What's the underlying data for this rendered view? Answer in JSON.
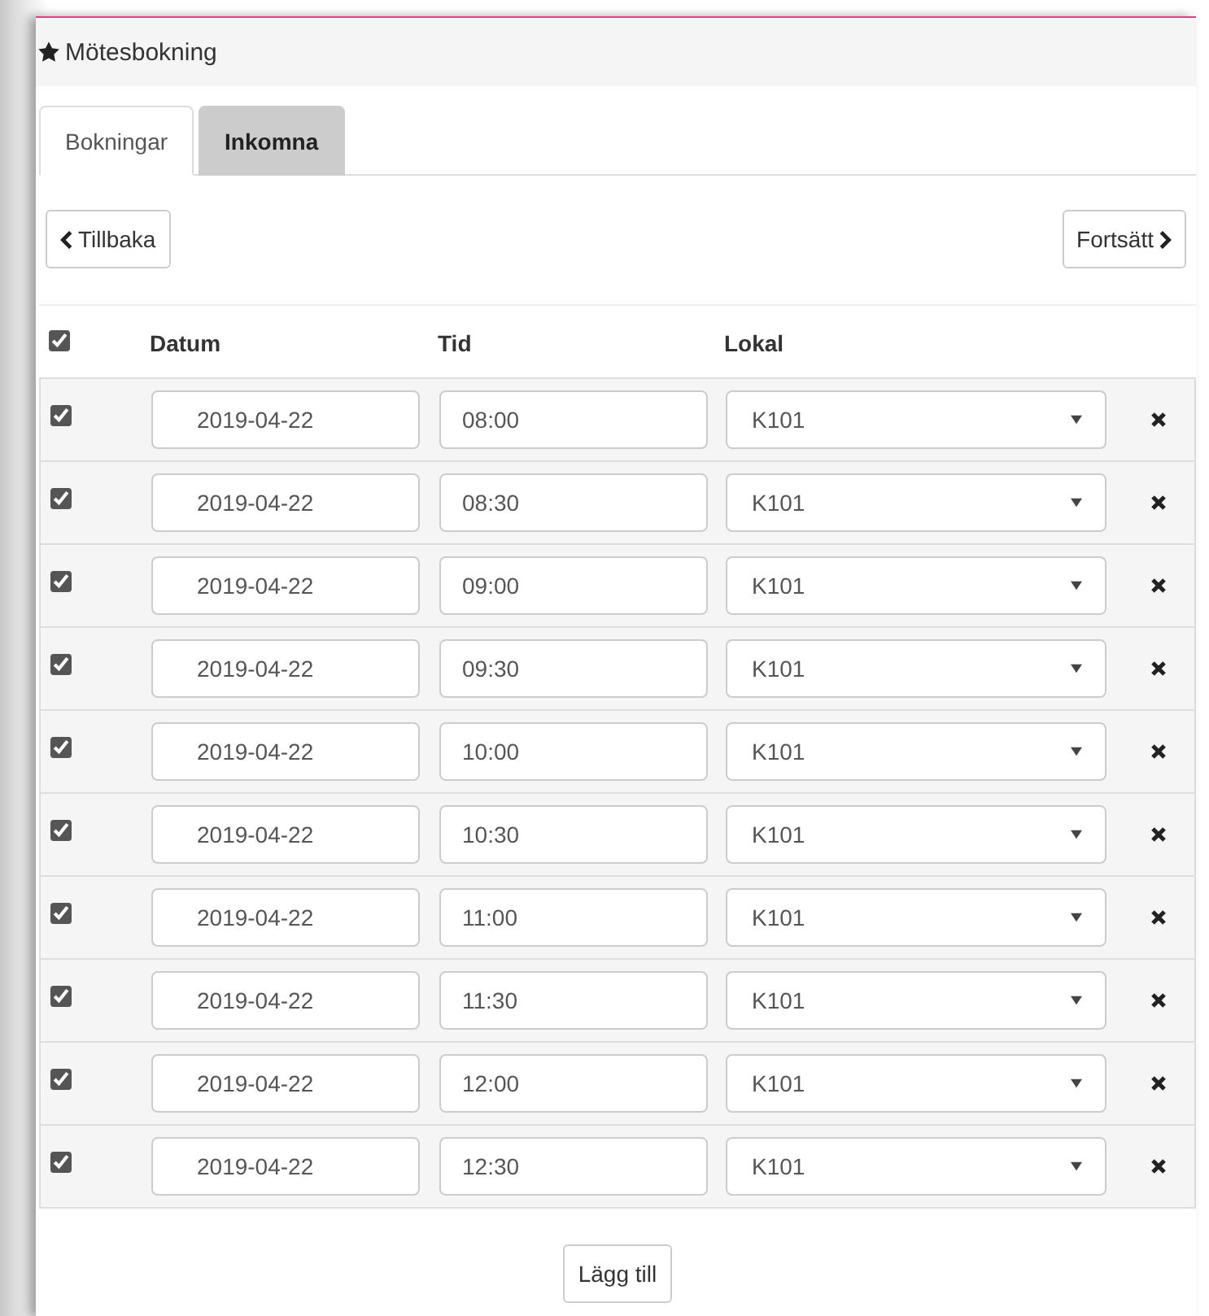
{
  "panel": {
    "title": "Mötesbokning"
  },
  "tabs": [
    {
      "label": "Bokningar",
      "selected": true
    },
    {
      "label": "Inkomna",
      "selected": false
    }
  ],
  "nav": {
    "back": "Tillbaka",
    "next": "Fortsätt"
  },
  "table": {
    "all_checked": true,
    "columns": [
      "Datum",
      "Tid",
      "Lokal"
    ],
    "rows": [
      {
        "checked": true,
        "date": "2019-04-22",
        "time": "08:00",
        "room": "K101"
      },
      {
        "checked": true,
        "date": "2019-04-22",
        "time": "08:30",
        "room": "K101"
      },
      {
        "checked": true,
        "date": "2019-04-22",
        "time": "09:00",
        "room": "K101"
      },
      {
        "checked": true,
        "date": "2019-04-22",
        "time": "09:30",
        "room": "K101"
      },
      {
        "checked": true,
        "date": "2019-04-22",
        "time": "10:00",
        "room": "K101"
      },
      {
        "checked": true,
        "date": "2019-04-22",
        "time": "10:30",
        "room": "K101"
      },
      {
        "checked": true,
        "date": "2019-04-22",
        "time": "11:00",
        "room": "K101"
      },
      {
        "checked": true,
        "date": "2019-04-22",
        "time": "11:30",
        "room": "K101"
      },
      {
        "checked": true,
        "date": "2019-04-22",
        "time": "12:00",
        "room": "K101"
      },
      {
        "checked": true,
        "date": "2019-04-22",
        "time": "12:30",
        "room": "K101"
      }
    ]
  },
  "add_button": "Lägg till"
}
